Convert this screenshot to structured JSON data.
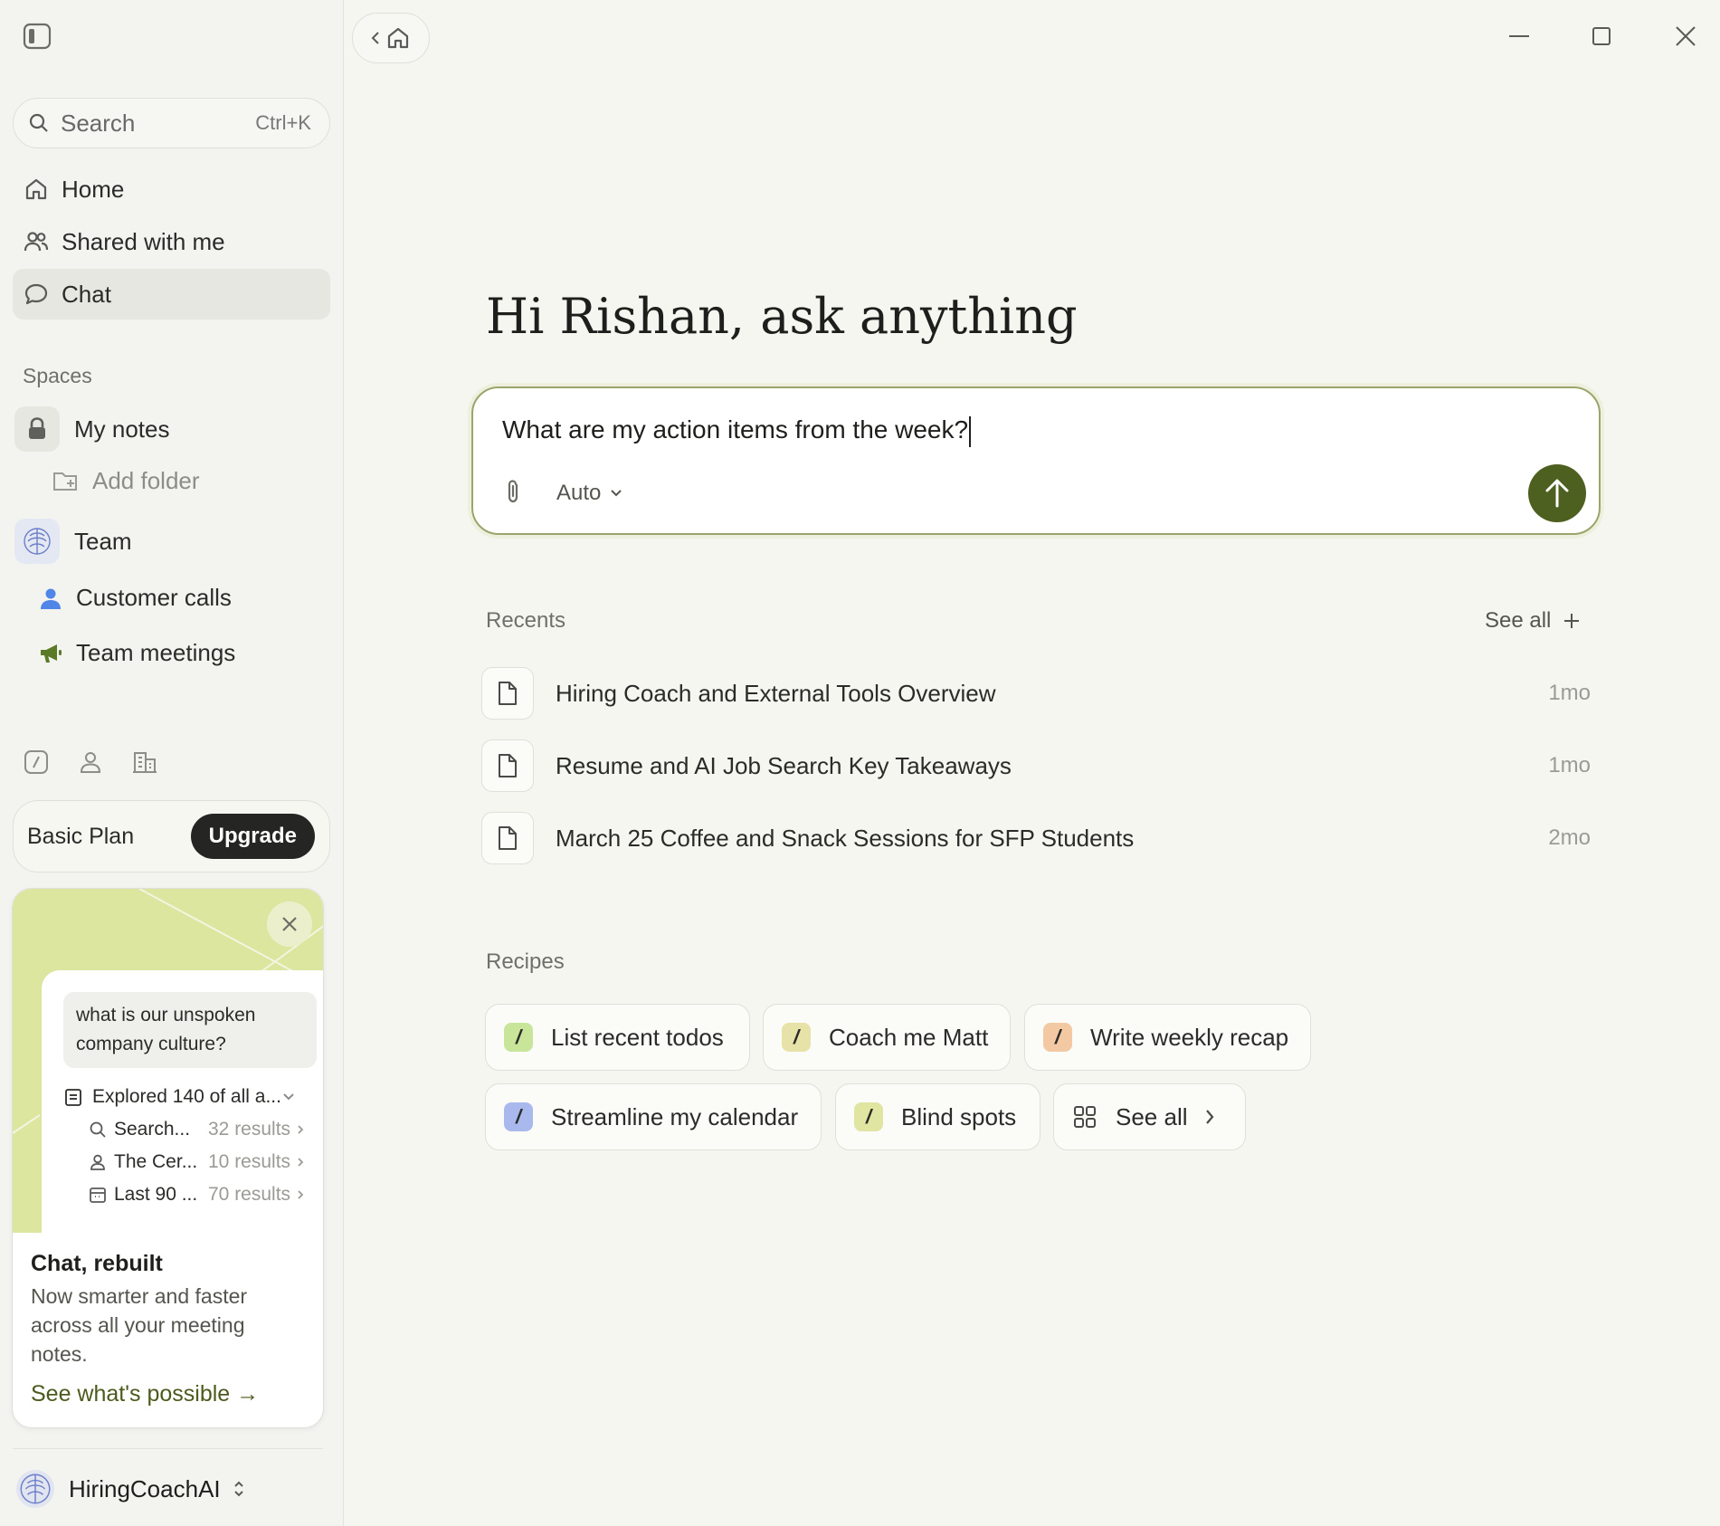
{
  "sidebar": {
    "search": {
      "label": "Search",
      "shortcut": "Ctrl+K"
    },
    "nav": [
      {
        "label": "Home",
        "icon": "home-icon"
      },
      {
        "label": "Shared with me",
        "icon": "people-icon"
      },
      {
        "label": "Chat",
        "icon": "chat-bubble-icon",
        "active": true
      }
    ],
    "spaces_label": "Spaces",
    "my_notes": "My notes",
    "add_folder": "Add folder",
    "team": "Team",
    "team_children": [
      {
        "label": "Customer calls",
        "icon": "person-icon",
        "color": "#4f86e8"
      },
      {
        "label": "Team meetings",
        "icon": "megaphone-icon",
        "color": "#5b7a28"
      }
    ],
    "plan": {
      "name": "Basic Plan",
      "cta": "Upgrade"
    },
    "promo": {
      "question": "what is our unspoken company culture?",
      "explored": "Explored 140 of all a...",
      "results": [
        {
          "name": "Search...",
          "count": "32 results"
        },
        {
          "name": "The Cer...",
          "count": "10 results"
        },
        {
          "name": "Last 90 ...",
          "count": "70 results"
        }
      ],
      "title": "Chat, rebuilt",
      "description": "Now smarter and faster across all your meeting notes.",
      "link": "See what's possible →"
    },
    "account": "HiringCoachAI"
  },
  "main": {
    "greeting": "Hi Rishan, ask anything",
    "composer": {
      "value": "What are my action items from the week?",
      "mode": "Auto"
    },
    "recents_label": "Recents",
    "see_all": "See all",
    "recents": [
      {
        "title": "Hiring Coach and External Tools Overview",
        "age": "1mo"
      },
      {
        "title": "Resume and AI Job Search Key Takeaways",
        "age": "1mo"
      },
      {
        "title": "March 25 Coffee and Snack Sessions for SFP Students",
        "age": "2mo"
      }
    ],
    "recipes_label": "Recipes",
    "recipes": [
      {
        "label": "List recent todos",
        "color": "#c9e59a"
      },
      {
        "label": "Coach me Matt",
        "color": "#e7e3a8"
      },
      {
        "label": "Write weekly recap",
        "color": "#f2c9a3"
      },
      {
        "label": "Streamline my calendar",
        "color": "#a9b9ee"
      },
      {
        "label": "Blind spots",
        "color": "#e0e5a1"
      }
    ],
    "recipes_see_all": "See all"
  },
  "colors": {
    "accent": "#4e6020",
    "background": "#f6f6f1"
  }
}
